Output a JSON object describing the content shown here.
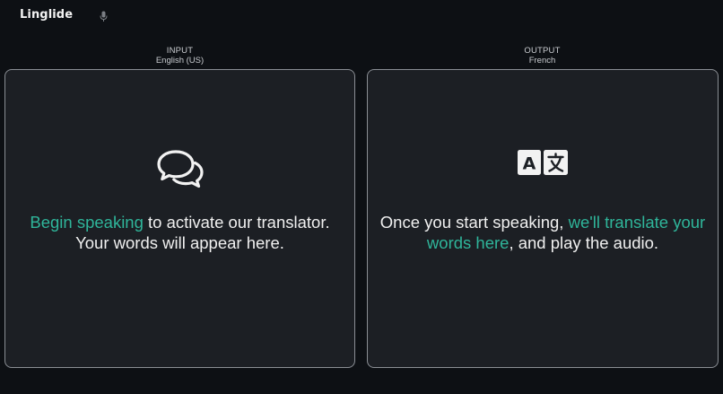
{
  "app": {
    "name": "Linglide",
    "mic_icon": "microphone-icon"
  },
  "colors": {
    "background": "#0d1014",
    "panel": "#1c1f24",
    "accent": "#2fb59a",
    "border": "#8a8e94"
  },
  "input": {
    "title": "INPUT",
    "language": "English (US)",
    "icon": "chat-bubbles-icon",
    "message_accent": "Begin speaking",
    "message_rest": " to activate our translator.",
    "message_line2": "Your words will appear here."
  },
  "output": {
    "title": "OUTPUT",
    "language": "French",
    "icon": "translate-icon",
    "icon_letter": "A",
    "message_start": "Once you start speaking, ",
    "message_accent": "we'll translate your words here",
    "message_end": ", and play the audio."
  }
}
